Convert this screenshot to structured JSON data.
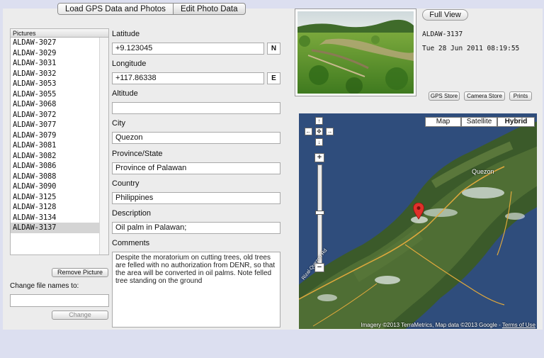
{
  "tabs": [
    {
      "label": "Load GPS Data and Photos"
    },
    {
      "label": "Edit Photo Data"
    }
  ],
  "pictures": {
    "header": "Pictures",
    "items": [
      "ALDAW-3027",
      "ALDAW-3029",
      "ALDAW-3031",
      "ALDAW-3032",
      "ALDAW-3053",
      "ALDAW-3055",
      "ALDAW-3068",
      "ALDAW-3072",
      "ALDAW-3077",
      "ALDAW-3079",
      "ALDAW-3081",
      "ALDAW-3082",
      "ALDAW-3086",
      "ALDAW-3088",
      "ALDAW-3090",
      "ALDAW-3125",
      "ALDAW-3128",
      "ALDAW-3134",
      "ALDAW-3137"
    ],
    "selected": "ALDAW-3137"
  },
  "buttons": {
    "remove_picture": "Remove Picture",
    "change": "Change",
    "full_view": "Full View",
    "gps_store": "GPS Store",
    "camera_store": "Camera Store",
    "prints": "Prints"
  },
  "rename": {
    "label": "Change file names to:",
    "value": ""
  },
  "fields": {
    "latitude": {
      "label": "Latitude",
      "value": "+9.123045",
      "suffix": "N"
    },
    "longitude": {
      "label": "Longitude",
      "value": "+117.86338",
      "suffix": "E"
    },
    "altitude": {
      "label": "Altitude",
      "value": ""
    },
    "city": {
      "label": "City",
      "value": "Quezon"
    },
    "province": {
      "label": "Province/State",
      "value": "Province of Palawan"
    },
    "country": {
      "label": "Country",
      "value": "Philippines"
    },
    "description": {
      "label": "Description",
      "value": "Oil palm in Palawan;"
    },
    "comments": {
      "label": "Comments",
      "value": "Despite the moratorium on cutting trees, old trees are felled with no authorization from DENR, so that the area will be converted in oil palms. Note felled tree standing on the ground"
    }
  },
  "photo": {
    "name": "ALDAW-3137",
    "timestamp": "Tue 28 Jun 2011 08:19:55"
  },
  "map": {
    "types": [
      {
        "label": "Map"
      },
      {
        "label": "Satellite"
      },
      {
        "label": "Hybrid"
      }
    ],
    "active_type": "Hybrid",
    "place_label": "Quezon",
    "road_label": "Rizal-Quezon Rd",
    "attribution_prefix": "Imagery ©2013 TerraMetrics, Map data ©2013 Google - ",
    "attribution_link": "Terms of Use"
  },
  "colors": {
    "accent_pin": "#e0302a",
    "selection": "#d4d4d4"
  }
}
